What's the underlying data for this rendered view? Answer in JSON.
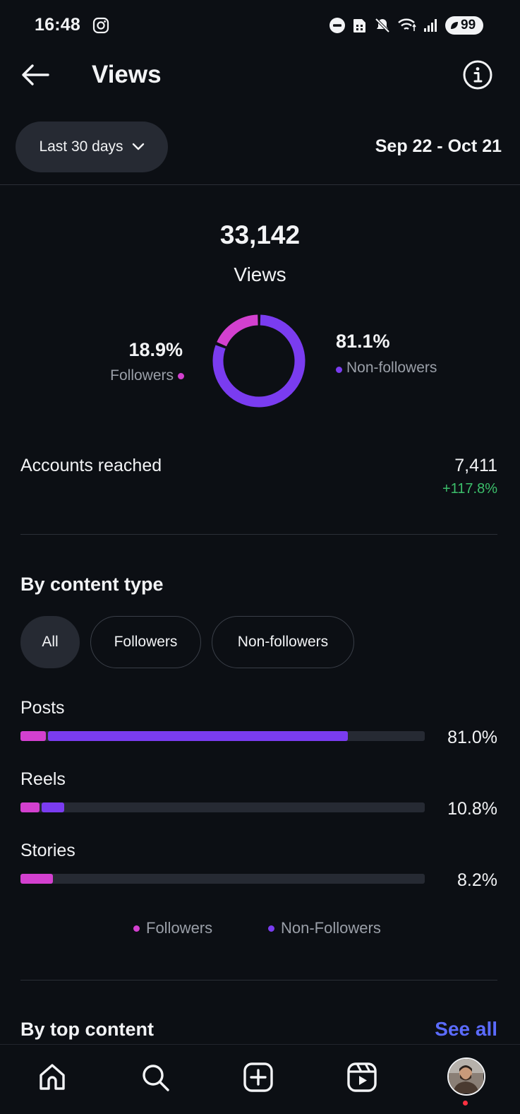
{
  "status_bar": {
    "time": "16:48",
    "battery": "99",
    "icons": [
      "instagram-icon",
      "do-not-disturb-icon",
      "sim-icon",
      "mute-icon",
      "wifi-icon",
      "signal-icon",
      "battery-icon"
    ]
  },
  "header": {
    "title": "Views",
    "back_icon": "back-arrow-icon",
    "info_icon": "info-icon"
  },
  "filter": {
    "range_label": "Last 30 days",
    "date_range": "Sep 22 - Oct 21"
  },
  "summary": {
    "total": "33,142",
    "label": "Views",
    "followers_pct": "18.9%",
    "followers_label": "Followers",
    "non_followers_pct": "81.1%",
    "non_followers_label": "Non-followers",
    "followers_share": 0.189
  },
  "reach": {
    "label": "Accounts reached",
    "value": "7,411",
    "change": "+117.8%"
  },
  "content_type": {
    "title": "By content type",
    "chips": [
      "All",
      "Followers",
      "Non-followers"
    ],
    "active_chip": "All",
    "rows": [
      {
        "label": "Posts",
        "pct": "81.0%",
        "total": 81.0,
        "followers": 6.3
      },
      {
        "label": "Reels",
        "pct": "10.8%",
        "total": 10.8,
        "followers": 4.7
      },
      {
        "label": "Stories",
        "pct": "8.2%",
        "total": 8.2,
        "followers": 8.0
      }
    ],
    "legend": [
      "Followers",
      "Non-Followers"
    ]
  },
  "top_content": {
    "title": "By top content",
    "see_all": "See all"
  },
  "colors": {
    "followers": "#d340cf",
    "non_followers": "#7a3cf0",
    "positive": "#3cbf6b",
    "link": "#5b6bff"
  },
  "bottom_nav": {
    "items": [
      "home-icon",
      "search-icon",
      "create-icon",
      "reels-icon",
      "profile-avatar"
    ]
  }
}
